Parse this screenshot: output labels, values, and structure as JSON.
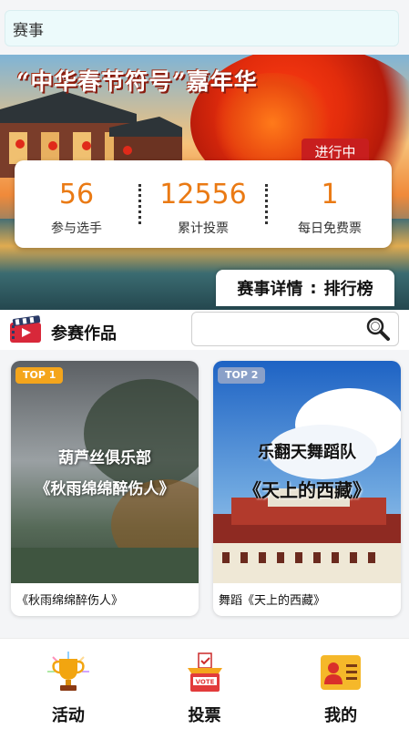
{
  "search_bar": {
    "placeholder": "赛事"
  },
  "banner": {
    "title": "“中华春节符号”嘉年华",
    "status_badge": "进行中",
    "stats": [
      {
        "value": "56",
        "label": "参与选手"
      },
      {
        "value": "12556",
        "label": "累计投票"
      },
      {
        "value": "1",
        "label": "每日免费票"
      }
    ],
    "tabs": {
      "detail": "赛事详情",
      "separator": ":",
      "ranking": "排行榜"
    }
  },
  "works_section": {
    "title": "参赛作品",
    "search_placeholder": "",
    "icon": "film-icon"
  },
  "entries": [
    {
      "rank": "TOP 1",
      "overlay_line1": "葫芦丝俱乐部",
      "overlay_line2": "《秋雨绵绵醉伤人》",
      "caption": "《秋雨绵绵醉伤人》"
    },
    {
      "rank": "TOP 2",
      "overlay_line1": "乐翻天舞蹈队",
      "overlay_line2": "《天上的西藏》",
      "caption": "舞蹈《天上的西藏》"
    }
  ],
  "bottom_nav": [
    {
      "label": "活动",
      "icon": "trophy-icon"
    },
    {
      "label": "投票",
      "icon": "vote-box-icon",
      "icon_text": "VOTE"
    },
    {
      "label": "我的",
      "icon": "profile-card-icon"
    }
  ],
  "colors": {
    "accent_orange": "#ea7a14",
    "status_red": "#c81e1e",
    "top1_badge": "#f4a51c",
    "top2_badge": "#8aa0c8"
  }
}
